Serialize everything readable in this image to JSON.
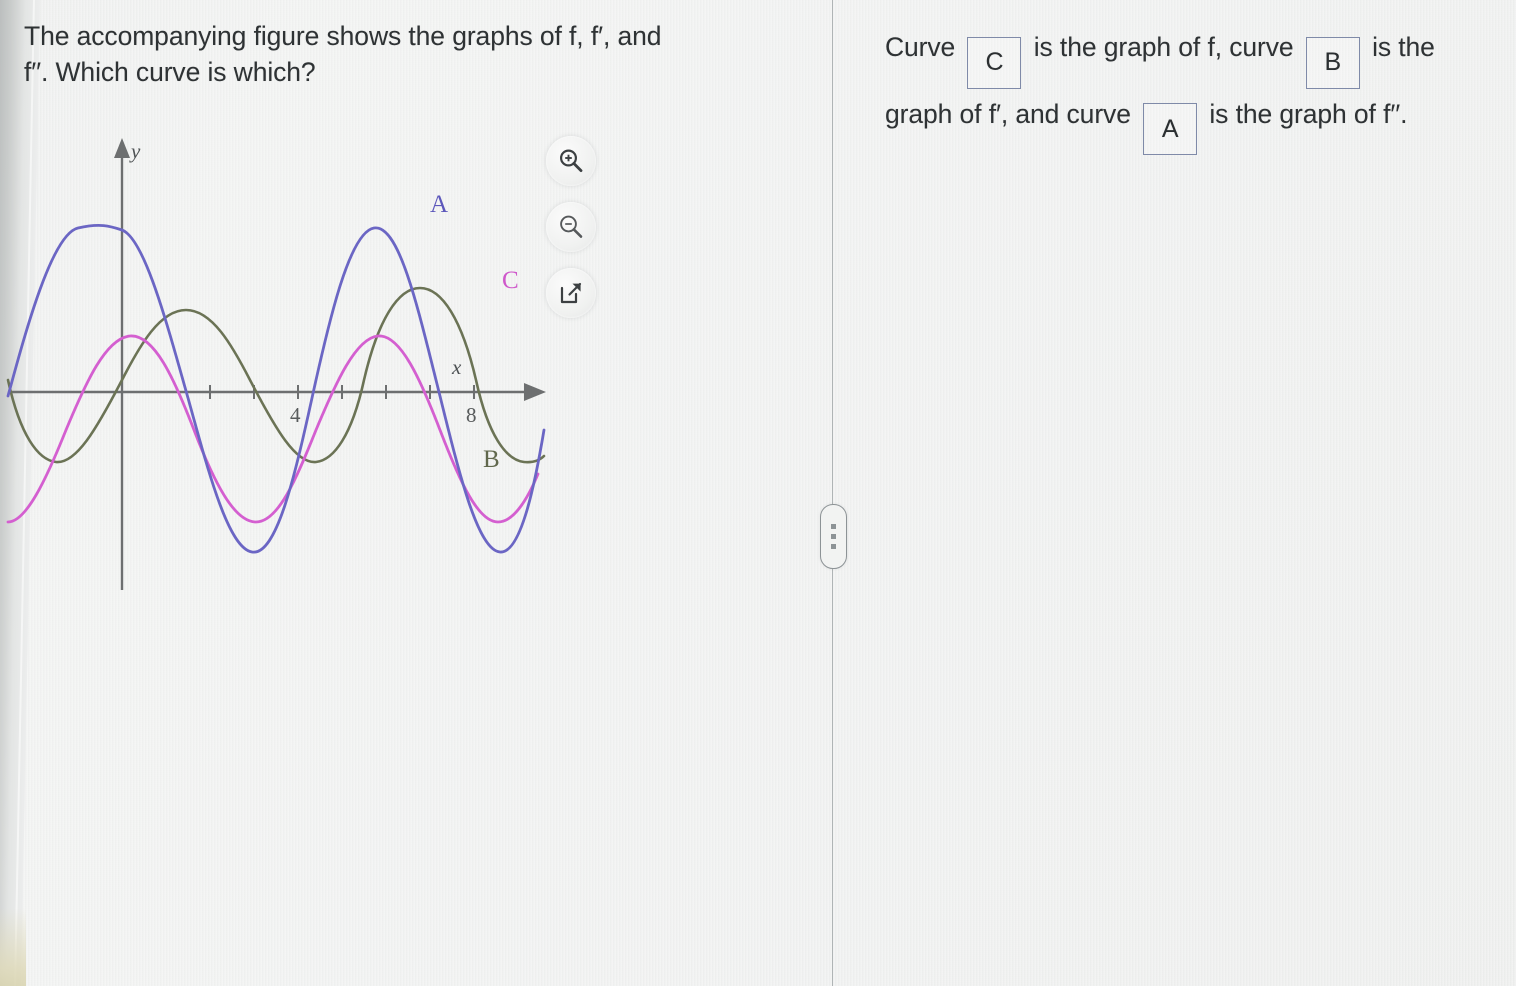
{
  "question": {
    "line1": "The accompanying figure shows the graphs of f, f′, and",
    "line2": "f′′. Which curve is which?"
  },
  "figure": {
    "axis_label_x": "x",
    "axis_label_y": "y",
    "tick_labels": [
      "4",
      "8"
    ],
    "curve_labels": [
      {
        "id": "A",
        "label": "A",
        "color": "#6b66c4"
      },
      {
        "id": "C",
        "label": "C",
        "color": "#d45fd0"
      },
      {
        "id": "B",
        "label": "B",
        "color": "#6b7355"
      }
    ],
    "toolbar": [
      {
        "icon": "zoom-in-icon",
        "label": "Zoom in"
      },
      {
        "icon": "zoom-out-icon",
        "label": "Zoom out"
      },
      {
        "icon": "open-in-new-window-icon",
        "label": "Open figure in new window"
      }
    ]
  },
  "answer": {
    "seg1": "Curve",
    "box1_value": "C",
    "seg2": "is the graph of f, curve",
    "box2_value": "B",
    "seg3": "is the",
    "seg4": "graph of f′, and curve",
    "box3_value": "A",
    "seg5": "is the graph of f′′."
  },
  "splitter": {
    "label": "pane-splitter-handle"
  },
  "chart_data": {
    "type": "line",
    "title": "",
    "xlabel": "x",
    "ylabel": "y",
    "xlim": [
      -1,
      10
    ],
    "ylim": [
      -4,
      4
    ],
    "xticks": [
      4,
      8
    ],
    "grid": false,
    "legend": "inline-curve-labels",
    "series": [
      {
        "name": "A",
        "color": "#6b66c4",
        "role": "largest amplitude",
        "form": "y = 3.6 cos(1.57 x)",
        "amplitude": 3.6,
        "period": 4,
        "phase_deg": 0,
        "annotation": "A"
      },
      {
        "name": "C",
        "color": "#d45fd0",
        "role": "medium amplitude",
        "form": "y = 2.4 sin(1.57 x)",
        "amplitude": 2.4,
        "period": 4,
        "phase_deg": -90,
        "annotation": "C"
      },
      {
        "name": "B",
        "color": "#6b7355",
        "role": "smallest amplitude",
        "form": "y = -1.7 cos(1.57 x)",
        "amplitude": 1.7,
        "period": 4,
        "phase_deg": 180,
        "annotation": "B"
      }
    ]
  }
}
